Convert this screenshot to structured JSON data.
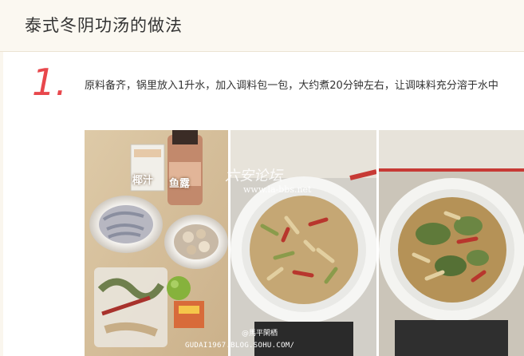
{
  "page": {
    "title": "泰式冬阴功汤的做法"
  },
  "step": {
    "number": "1.",
    "text": "原料备齐，锅里放入1升水，加入调料包一包，大约煮20分钟左右，让调味料充分溶于水中"
  },
  "photos": {
    "label_coconut": "椰汁",
    "label_fish_sauce": "鱼露",
    "watermark_site": "www.la-bbs.net",
    "watermark_brand": "六安论坛",
    "seal_text": "@馬平閑栖",
    "credit": "GUDAI1967.BLOG.SOHU.COM/"
  },
  "colors": {
    "step_number": "#e8474c",
    "title": "#333333"
  }
}
